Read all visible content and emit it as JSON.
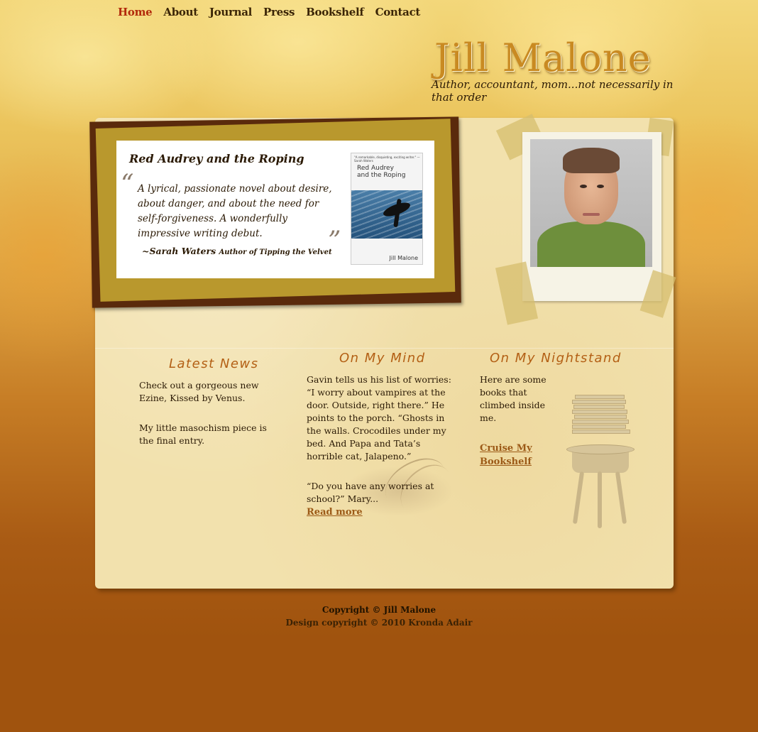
{
  "nav": {
    "items": [
      {
        "label": "Home",
        "active": true
      },
      {
        "label": "About"
      },
      {
        "label": "Journal"
      },
      {
        "label": "Press"
      },
      {
        "label": "Bookshelf"
      },
      {
        "label": "Contact"
      }
    ]
  },
  "header": {
    "title": "Jill Malone",
    "tagline": "Author, accountant, mom...not necessarily in that order"
  },
  "feature": {
    "title": "Red Audrey and the Roping",
    "open_quote": "“",
    "close_quote": "”",
    "quote": "A lyrical, passionate novel about desire, about danger, and about the need for self-forgiveness. A wonderfully impressive writing debut.",
    "attribution_name": "~Sarah Waters",
    "attribution_role": "Author of Tipping the Velvet",
    "cover": {
      "blurb": "\"A remarkable, disquieting, exciting writer.\" — Sarah Waters",
      "title_line1": "Red Audrey",
      "title_line2": "and the Roping",
      "author": "Jill Malone"
    }
  },
  "columns": {
    "news": {
      "heading": "Latest News",
      "p1": "Check out a gorgeous new Ezine, Kissed by Venus.",
      "p2": "My little masochism piece is the final entry."
    },
    "mind": {
      "heading": "On My Mind",
      "p1": "Gavin tells us his list of worries: “I worry about vampires at the door. Outside, right there.” He points to the porch. “Ghosts in the walls. Crocodiles under my bed. And Papa and Tata’s horrible cat, Jalapeno.”",
      "p2": "“Do you have any worries at school?” Mary...",
      "link": "Read more"
    },
    "nightstand": {
      "heading": "On My Nightstand",
      "p1": "Here are some books that climbed inside me.",
      "link": "Cruise My Bookshelf"
    }
  },
  "footer": {
    "line1": "Copyright © Jill Malone",
    "line2": "Design copyright © 2010 Kronda Adair"
  },
  "colors": {
    "background": "#a0530e",
    "nav_active": "#b22a0c",
    "panel": "#f2e1ad",
    "heading_accent": "#b35f14",
    "frame_gold": "#b9982d",
    "frame_dark": "#5a2a0c"
  }
}
